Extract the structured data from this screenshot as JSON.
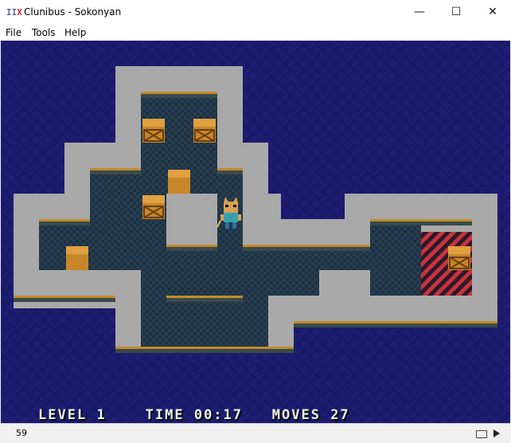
{
  "window": {
    "title": "Clunibus - Sokonyan",
    "icon": "app-icon",
    "icon_text_a": "II",
    "icon_text_b": "X",
    "minimize_glyph": "—",
    "maximize_glyph": "☐",
    "close_glyph": "✕"
  },
  "menu": {
    "items": [
      "File",
      "Tools",
      "Help"
    ]
  },
  "game": {
    "background_color": "#1b1b6e",
    "wall_color": "#a9a9a9",
    "floor_color": "#1e3142",
    "goal_color": "#c8323c",
    "crate_color": "#c8862a",
    "level_label": "LEVEL",
    "level_value": "1",
    "time_label": "TIME",
    "time_value": "00:17",
    "moves_label": "MOVES",
    "moves_value": "27"
  },
  "status": {
    "fps": "59",
    "keyboard_icon": "keyboard-icon",
    "play_icon": "play-icon"
  }
}
